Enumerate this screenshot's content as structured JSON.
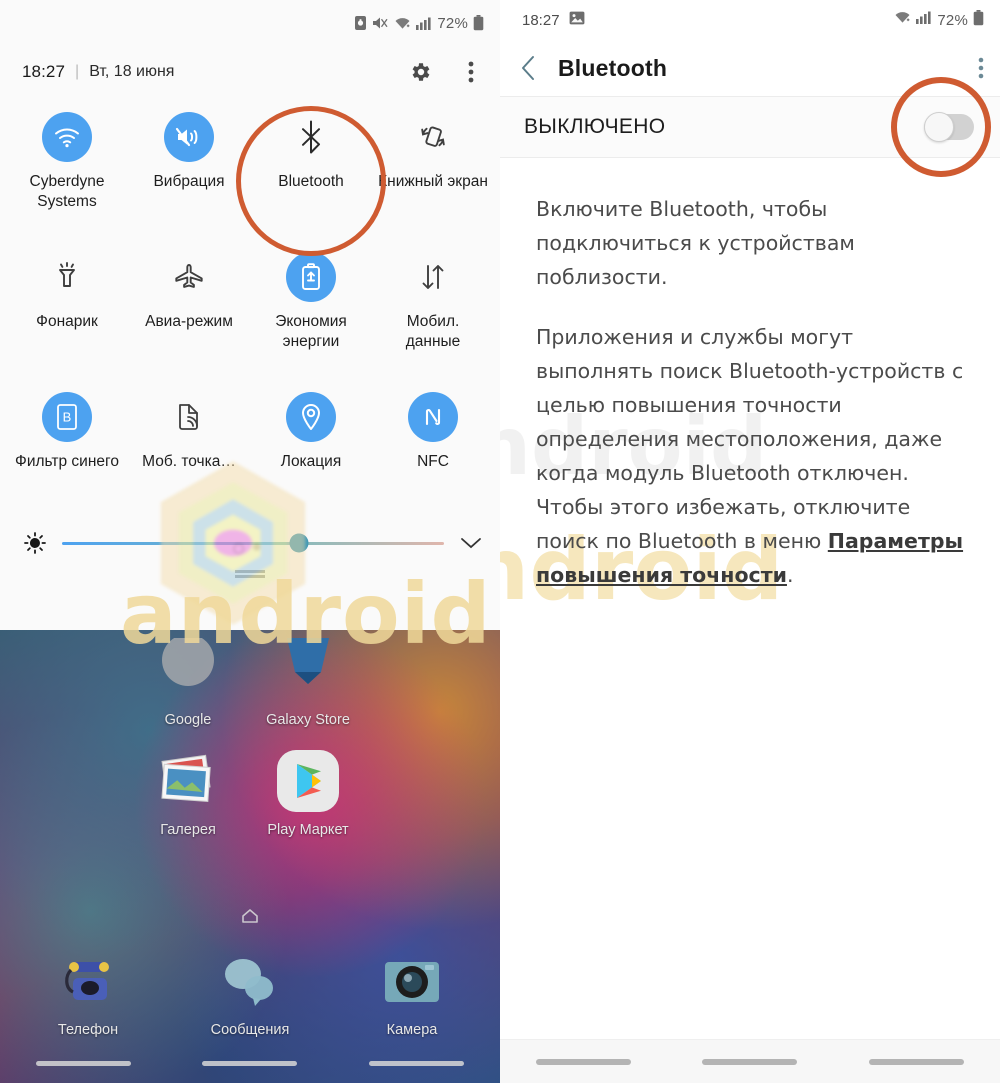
{
  "left_panel": {
    "status_bar": {
      "icons": [
        "sim-card-icon",
        "mute-vibrate-icon",
        "wifi-icon",
        "signal-icon"
      ],
      "battery_text": "72%",
      "battery_icon": "battery-icon"
    },
    "quick_settings_header": {
      "time": "18:27",
      "separator": "|",
      "date": "Вт, 18 июня",
      "settings_icon": "gear-icon",
      "more_icon": "more-vertical-icon"
    },
    "tiles": [
      {
        "label": "Cyberdyne Systems",
        "icon": "wifi-icon",
        "state": "on"
      },
      {
        "label": "Вибрация",
        "icon": "vibrate-icon",
        "state": "on"
      },
      {
        "label": "Bluetooth",
        "icon": "bluetooth-icon",
        "state": "off",
        "highlighted": true
      },
      {
        "label": "Книжный экран",
        "icon": "screen-rotation-icon",
        "state": "off"
      },
      {
        "label": "Фонарик",
        "icon": "flashlight-icon",
        "state": "off"
      },
      {
        "label": "Авиа-режим",
        "icon": "airplane-icon",
        "state": "off"
      },
      {
        "label": "Экономия энергии",
        "icon": "power-saving-icon",
        "state": "on"
      },
      {
        "label": "Мобил. данные",
        "icon": "data-transfer-icon",
        "state": "off"
      },
      {
        "label": "Фильтр синего",
        "icon": "blue-light-filter-icon",
        "state": "on"
      },
      {
        "label": "Моб. точка…",
        "icon": "hotspot-icon",
        "state": "off"
      },
      {
        "label": "Локация",
        "icon": "location-pin-icon",
        "state": "on"
      },
      {
        "label": "NFC",
        "icon": "nfc-icon",
        "state": "on"
      }
    ],
    "brightness": {
      "icon": "brightness-icon",
      "value_percent": 62,
      "expand_icon": "chevron-down-icon"
    },
    "watermark_text": "android",
    "home_screen": {
      "row1": [
        {
          "label": "Google",
          "icon": "google-folder-icon"
        },
        {
          "label": "Galaxy Store",
          "icon": "galaxy-store-icon"
        }
      ],
      "row2": [
        {
          "label": "Галерея",
          "icon": "gallery-icon"
        },
        {
          "label": "Play Маркет",
          "icon": "play-store-icon"
        }
      ],
      "row3": [
        {
          "label": "Телефон",
          "icon": "phone-icon"
        },
        {
          "label": "Сообщения",
          "icon": "messages-icon"
        },
        {
          "label": "Камера",
          "icon": "camera-icon"
        }
      ],
      "page_indicator_icon": "home-page-icon"
    }
  },
  "right_panel": {
    "status_bar": {
      "time": "18:27",
      "left_icon": "image-notification-icon",
      "wifi_icon": "wifi-icon",
      "signal_icon": "signal-icon",
      "battery_text": "72%",
      "battery_icon": "battery-icon"
    },
    "app_bar": {
      "back_icon": "back-chevron-icon",
      "title": "Bluetooth",
      "more_icon": "more-vertical-icon"
    },
    "switch_row": {
      "label": "ВЫКЛЮЧЕНО",
      "state": "off",
      "highlighted": true
    },
    "body": {
      "paragraph1": "Включите Bluetooth, чтобы подключиться к устройствам поблизости.",
      "paragraph2_before_link": "Приложения и службы могут выполнять поиск Bluetooth-устройств с целью повышения точности определения местоположения, даже когда модуль Bluetooth отключен. Чтобы этого избежать, отключите поиск по Bluetooth в меню ",
      "paragraph2_link": "Параметры повышения точности",
      "paragraph2_after_link": "."
    },
    "watermark_text": "android",
    "nav_bar": {
      "recents": "nav-recents-pill",
      "home": "nav-home-pill",
      "back": "nav-back-pill"
    }
  },
  "colors": {
    "accent_highlight": "#cf5b31",
    "tile_on": "#4da2f0",
    "watermark": "#f0d99a"
  }
}
